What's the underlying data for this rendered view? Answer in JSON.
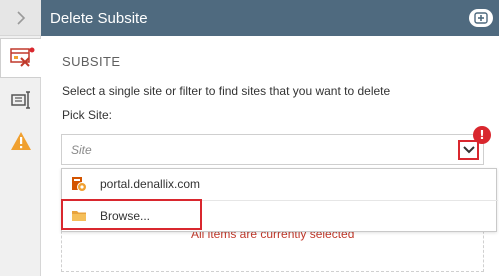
{
  "header": {
    "title": "Delete Subsite"
  },
  "section": {
    "title": "SUBSITE"
  },
  "form": {
    "description": "Select a single site or filter to find sites that you want to delete",
    "pick_label": "Pick Site:",
    "site_placeholder": "Site"
  },
  "dropdown": {
    "items": [
      {
        "label": "portal.denallix.com",
        "icon": "site-icon"
      },
      {
        "label": "Browse...",
        "icon": "folder-icon"
      }
    ]
  },
  "status": {
    "message": "All items are currently selected"
  },
  "colors": {
    "header_bg": "#4f6a7f",
    "accent_red": "#d9272e",
    "warning_orange": "#f0a030"
  }
}
